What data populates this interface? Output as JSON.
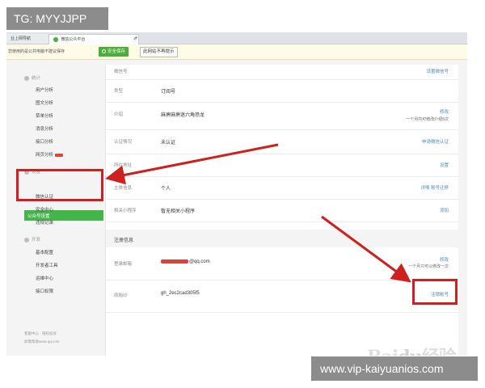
{
  "overlay": {
    "tg": "TG: MYYJJPP",
    "url": "www.vip-kaiyuanios.com"
  },
  "browser": {
    "tabs": [
      {
        "label": "业上网导航"
      },
      {
        "label": "微信公众平台"
      }
    ],
    "tab_close": "×",
    "tab_plus": "+",
    "notice_text": "您使用的是公共电脑不建议保存",
    "save_button": "安全保存",
    "nosave_button": "此网站不再提示"
  },
  "sidebar": {
    "stats_section": "统计",
    "stats_items": [
      "用户分析",
      "图文分析",
      "菜单分析",
      "消息分析",
      "接口分析",
      "网页分析"
    ],
    "settings_section": "设置",
    "settings_items": [
      "公众号设置",
      "微信认证",
      "安全中心",
      "违规记录"
    ],
    "dev_section": "开发",
    "dev_items": [
      "基本配置",
      "开发者工具",
      "运维中心",
      "接口权限"
    ],
    "footer_1": "客服中心 · 侵权投诉",
    "footer_2": "如需帮助www.qq.com"
  },
  "account": {
    "top_label": "微信号",
    "top_link": "设置微信号",
    "rows": [
      {
        "label": "类型",
        "value": "订阅号",
        "link": ""
      },
      {
        "label": "介绍",
        "value": "麻痹麻痹迷六角恐龙",
        "link": "修改",
        "sub": "一个月内可修改介绍5次"
      },
      {
        "label": "认证情况",
        "value": "未认证",
        "link": "申请微信认证"
      },
      {
        "label": "所在地址",
        "value": "",
        "link": "设置"
      },
      {
        "label": "主体信息",
        "value": "个人",
        "link": "详情 账号迁移"
      },
      {
        "label": "相关小程序",
        "value": "暂无相关小程序",
        "link": "添加"
      }
    ]
  },
  "registration": {
    "title": "注册信息",
    "email_label": "登录邮箱",
    "email_suffix": "@qq.com",
    "email_link": "修改",
    "email_sub": "一个月只可以修改一次",
    "origin_label": "原始ID",
    "origin_value": "gh_2ec2cad305f5",
    "origin_link": "注销帐号"
  },
  "watermark": {
    "logo": "Baidu经验"
  },
  "colors": {
    "accent_green": "#44b549",
    "highlight_red": "#cf2020",
    "link_blue": "#4a88c4"
  }
}
